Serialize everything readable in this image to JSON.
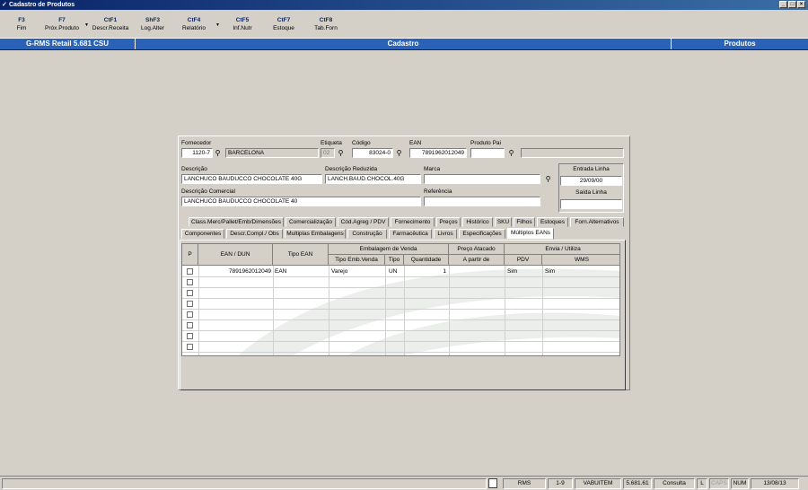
{
  "window": {
    "title": "Cadastro de Produtos"
  },
  "toolbar": [
    {
      "key": "F3",
      "label": "Fim"
    },
    {
      "key": "F7",
      "label": "Próx.Produto"
    },
    {
      "key": "CtF1",
      "label": "Descr.Receita"
    },
    {
      "key": "ShF3",
      "label": "Log.Alter"
    },
    {
      "key": "CtF4",
      "label": "Relatório"
    },
    {
      "key": "CtF5",
      "label": "Inf.Nutr"
    },
    {
      "key": "CtF7",
      "label": "Estoque"
    },
    {
      "key": "CtF8",
      "label": "Tab.Forn"
    }
  ],
  "status": {
    "app": "G-RMS Retail 5.681 CSU",
    "mode": "Cadastro",
    "module": "Produtos"
  },
  "form": {
    "fornecedor_label": "Fornecedor",
    "fornecedor_code": "1120-7",
    "fornecedor_name": "BARCELONA",
    "etiqueta_label": "Etiqueta",
    "etiqueta": "02",
    "codigo_label": "Código",
    "codigo": "83024-0",
    "ean_label": "EAN",
    "ean": "7891962012049",
    "produto_pai_label": "Produto Pai",
    "produto_pai": "",
    "descricao_label": "Descrição",
    "descricao": "LANCHUCO BAUDUCCO CHOCOLATE 40G",
    "descricao_reduzida_label": "Descrição Reduzida",
    "descricao_reduzida": "LANCH.BAUD.CHOCOL.40G",
    "marca_label": "Marca",
    "marca": "",
    "descricao_comercial_label": "Descrição Comercial",
    "descricao_comercial": "LANCHUCO BAUDUCCO CHOCOLATE 40",
    "referencia_label": "Referência",
    "referencia": "",
    "entrada_linha_label": "Entrada Linha",
    "entrada_linha": "29/09/00",
    "saida_linha_label": "Saída Linha",
    "saida_linha": ""
  },
  "tabs_row1": [
    "Class.Merc/Pallet/Emb/Dimensões",
    "Comercialização",
    "Cód.Agreg / PDV",
    "Fornecimento",
    "Preços",
    "Histórico",
    "SKU",
    "Filhos",
    "Estoques",
    "Forn.Alternativos"
  ],
  "tabs_row2": [
    "Componentes",
    "Descr.Compl./ Obs",
    "Multiplas Embalagens",
    "Construção",
    "Farmacêutica",
    "Livros",
    "Especificações",
    "Múltiplos EANs"
  ],
  "grid": {
    "headers": {
      "p": "P",
      "ean_dun": "EAN / DUN",
      "tipo_ean": "Tipo EAN",
      "embalagem_venda": "Embalagem de Venda",
      "tipo_emb_venda": "Tipo Emb.Venda",
      "tipo": "Tipo",
      "quantidade": "Quantidade",
      "preco_atacado": "Preço Atacado",
      "a_partir_de": "A partir de",
      "envia_utiliza": "Envia / Utiliza",
      "pdv": "PDV",
      "wms": "WMS"
    },
    "rows": [
      {
        "ean": "7891962012049",
        "tipo_ean": "EAN",
        "tipo_emb": "Varejo",
        "tipo": "UN",
        "qtd": "1",
        "a_partir": "",
        "pdv": "Sim",
        "wms": "Sim"
      }
    ]
  },
  "bottom_status": [
    "RMS",
    "1-9",
    "VABUITEM",
    "5.681.61",
    "Consulta",
    "L",
    "CAPS",
    "NUM",
    "13/08/13"
  ]
}
